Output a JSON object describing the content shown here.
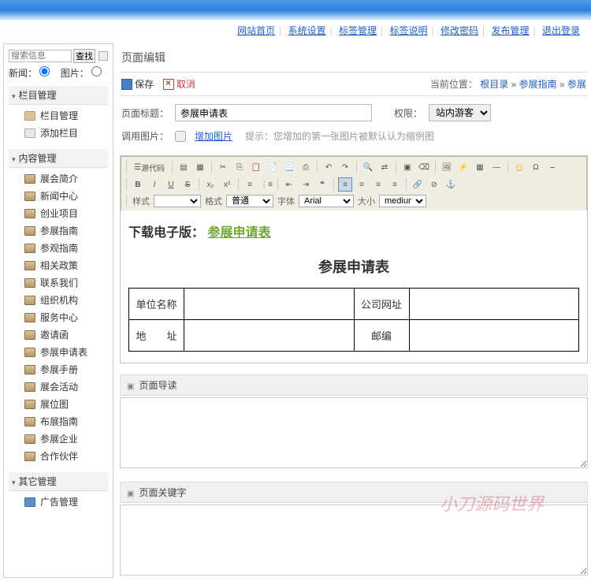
{
  "topnav": {
    "home": "网站首页",
    "sys": "系统设置",
    "tagmgr": "标签管理",
    "tagdesc": "标签说明",
    "pwd": "修改密码",
    "publish": "发布管理",
    "logout": "退出登录"
  },
  "search": {
    "placeholder": "搜索信息",
    "btn": "查找"
  },
  "radio": {
    "news": "新闻：",
    "pic": "图片："
  },
  "cats": {
    "col": {
      "title": "栏目管理",
      "items": [
        "栏目管理",
        "添加栏目"
      ]
    },
    "content": {
      "title": "内容管理",
      "items": [
        "展会简介",
        "新闻中心",
        "创业项目",
        "参展指南",
        "参观指南",
        "相关政策",
        "联系我们",
        "组织机构",
        "服务中心",
        "邀请函",
        "参展申请表",
        "参展手册",
        "展会活动",
        "展位图",
        "布展指南",
        "参展企业",
        "合作伙伴"
      ]
    },
    "other": {
      "title": "其它管理",
      "items": [
        "广告管理"
      ]
    }
  },
  "page": {
    "title": "页面编辑"
  },
  "actions": {
    "save": "保存",
    "cancel": "取消"
  },
  "crumb": {
    "label": "当前位置：",
    "root": "根目录",
    "c1": "参展指南",
    "c2": "参展"
  },
  "form": {
    "titleLbl": "页面标题：",
    "titleVal": "参展申请表",
    "permLbl": "权限：",
    "permVal": "站内游客",
    "imgLbl": "调用图片：",
    "addImg": "增加图片",
    "hint": "提示：您增加的第一张图片被默认认为缩例图"
  },
  "toolbar": {
    "source": "源代码",
    "styleLbl": "样式",
    "styleVal": "",
    "formatLbl": "格式",
    "formatVal": "普通",
    "fontLbl": "字体",
    "fontVal": "Arial",
    "sizeLbl": "大小",
    "sizeVal": "medium"
  },
  "doc": {
    "dlLabel": "下载电子版：",
    "dlLink": "参展申请表",
    "tblTitle": "参展申请表",
    "row1a": "单位名称",
    "row1b": "公司网址",
    "row2a": "地　　址",
    "row2b": "邮编"
  },
  "sections": {
    "s1": "页面导读",
    "s2": "页面关键字"
  },
  "watermark": "小刀源码世界"
}
